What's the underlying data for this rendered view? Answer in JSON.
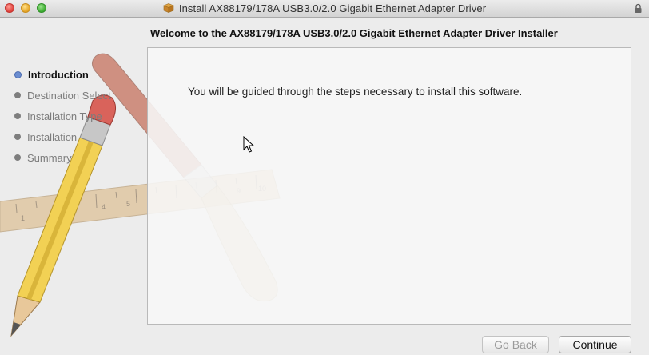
{
  "window": {
    "title": "Install AX88179/178A USB3.0/2.0 Gigabit Ethernet Adapter Driver",
    "title_icon": "package-icon",
    "lock_icon": "lock-icon"
  },
  "heading": "Welcome to the AX88179/178A USB3.0/2.0 Gigabit Ethernet Adapter Driver Installer",
  "steps": [
    {
      "label": "Introduction",
      "active": true
    },
    {
      "label": "Destination Select",
      "active": false
    },
    {
      "label": "Installation Type",
      "active": false
    },
    {
      "label": "Installation",
      "active": false
    },
    {
      "label": "Summary",
      "active": false
    }
  ],
  "panel": {
    "body_text": "You will be guided through the steps necessary to install this software."
  },
  "buttons": {
    "go_back": "Go Back",
    "continue": "Continue"
  },
  "colors": {
    "active_step_dot": "#6b8dd0",
    "inactive_step_dot": "#7e7e7e"
  }
}
